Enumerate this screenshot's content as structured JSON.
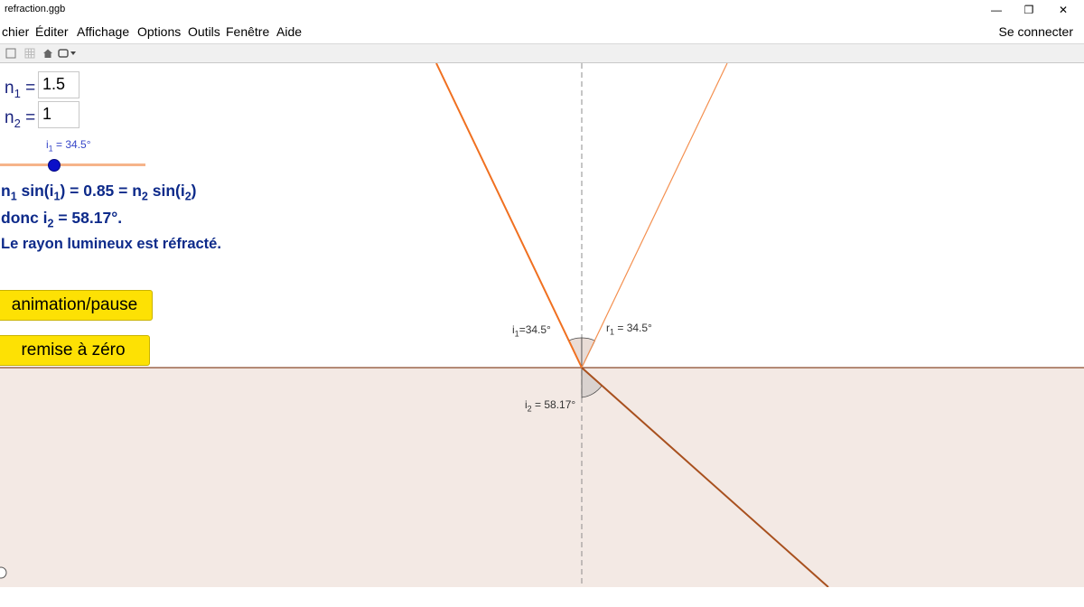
{
  "window": {
    "title": "refraction.ggb",
    "minimize_glyph": "—",
    "restore_glyph": "❐",
    "close_glyph": "✕"
  },
  "menu": {
    "items": [
      "chier",
      "Éditer",
      "Affichage",
      "Options",
      "Outils",
      "Fenêtre",
      "Aide"
    ],
    "connect": "Se connecter"
  },
  "toolbar": {
    "icons": [
      "graphics-view-icon",
      "grid-icon",
      "home-icon",
      "undo-redo-icon"
    ]
  },
  "inputs": {
    "n1": {
      "label_main": "n",
      "label_sub": "1",
      "eq": "=",
      "value": "1.5"
    },
    "n2": {
      "label_main": "n",
      "label_sub": "2",
      "eq": "=",
      "value": "1"
    }
  },
  "slider": {
    "label_main": "i",
    "label_sub": "1",
    "label_rest": " = 34.5°",
    "value_deg": 34.5,
    "accent": "#0b10c8",
    "track": "#f6b48a"
  },
  "text": {
    "line1": {
      "a": "n",
      "a_sub": "1",
      "b": " sin(i",
      "b_sub": "1",
      "c": ") = 0.85 = n",
      "c_sub": "2",
      "d": " sin(i",
      "d_sub": "2",
      "e": ")"
    },
    "line2": {
      "a": "donc  i",
      "a_sub": "2",
      "b": " = 58.17°."
    },
    "line3": "Le rayon lumineux est réfracté."
  },
  "buttons": {
    "animation": "animation/pause",
    "reset": "remise à zéro"
  },
  "diagram": {
    "incident_angle_deg": 34.5,
    "reflected_angle_deg": 34.5,
    "refracted_angle_deg": 58.17,
    "labels": {
      "i1": {
        "main": "i",
        "sub": "1",
        "rest": "=34.5°"
      },
      "r1": {
        "main": "r",
        "sub": "1",
        "rest": " = 34.5°"
      },
      "i2": {
        "main": "i",
        "sub": "2",
        "rest": " = 58.17°"
      }
    },
    "colors": {
      "incident": "#f07020",
      "reflected": "#f49050",
      "refracted": "#a8501e",
      "interface": "#8b4a2a",
      "normal": "#888888",
      "lower_medium": "#f3e9e4"
    }
  }
}
